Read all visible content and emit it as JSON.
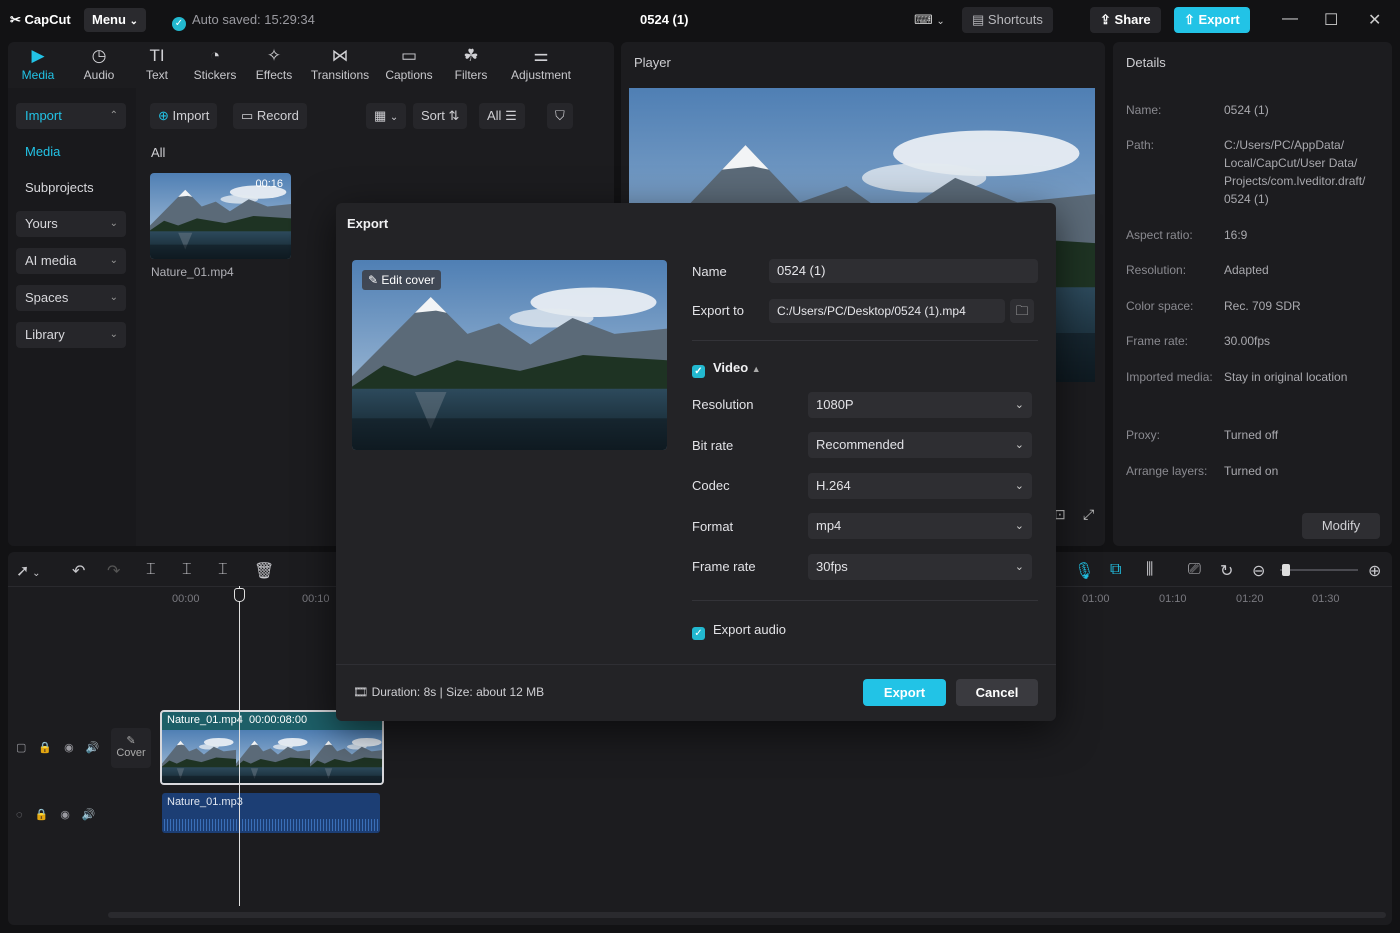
{
  "app": {
    "logo": "CapCut",
    "menu_label": "Menu",
    "autosave": "Auto saved: 15:29:34",
    "project_title": "0524 (1)",
    "shortcuts_label": "Shortcuts",
    "share_label": "Share",
    "export_label": "Export"
  },
  "toolbar": [
    "Media",
    "Audio",
    "Text",
    "Stickers",
    "Effects",
    "Transitions",
    "Captions",
    "Filters",
    "Adjustment"
  ],
  "sidebar": {
    "import": "Import",
    "media": "Media",
    "subprojects": "Subprojects",
    "yours": "Yours",
    "ai_media": "AI media",
    "spaces": "Spaces",
    "library": "Library"
  },
  "media_toolbar": {
    "import": "Import",
    "record": "Record",
    "sort": "Sort",
    "all": "All"
  },
  "media_panel": {
    "filter_all": "All",
    "clip_name": "Nature_01.mp4",
    "clip_duration": "00:16"
  },
  "player": {
    "title": "Player"
  },
  "details": {
    "title": "Details",
    "rows": [
      {
        "label": "Name:",
        "value": "0524 (1)"
      },
      {
        "label": "Path:",
        "value": "C:/Users/PC/AppData/ Local/CapCut/User Data/ Projects/com.lveditor.draft/ 0524 (1)"
      },
      {
        "label": "Aspect ratio:",
        "value": "16:9"
      },
      {
        "label": "Resolution:",
        "value": "Adapted"
      },
      {
        "label": "Color space:",
        "value": "Rec. 709 SDR"
      },
      {
        "label": "Frame rate:",
        "value": "30.00fps"
      },
      {
        "label": "Imported media:",
        "value": "Stay in original location"
      },
      {
        "label": "Proxy:",
        "value": "Turned off"
      },
      {
        "label": "Arrange layers:",
        "value": "Turned on"
      }
    ],
    "modify_label": "Modify"
  },
  "timeline": {
    "ruler": [
      "00:00",
      "00:10",
      "01:00",
      "01:10",
      "01:20",
      "01:30"
    ],
    "cover_label": "Cover",
    "video_clip_name": "Nature_01.mp4",
    "video_clip_time": "00:00:08:00",
    "audio_clip_name": "Nature_01.mp3"
  },
  "export_dialog": {
    "title": "Export",
    "edit_cover": "Edit cover",
    "name_label": "Name",
    "name_value": "0524 (1)",
    "export_to_label": "Export to",
    "export_to_value": "C:/Users/PC/Desktop/0524 (1).mp4",
    "video_label": "Video",
    "settings": [
      {
        "label": "Resolution",
        "value": "1080P"
      },
      {
        "label": "Bit rate",
        "value": "Recommended"
      },
      {
        "label": "Codec",
        "value": "H.264"
      },
      {
        "label": "Format",
        "value": "mp4"
      },
      {
        "label": "Frame rate",
        "value": "30fps"
      }
    ],
    "export_audio_label": "Export audio",
    "footer_info": "Duration: 8s | Size: about 12 MB",
    "export_button": "Export",
    "cancel_button": "Cancel"
  },
  "colors": {
    "accent": "#22c3e6",
    "background": "#121214",
    "panel": "#1c1c1f"
  }
}
